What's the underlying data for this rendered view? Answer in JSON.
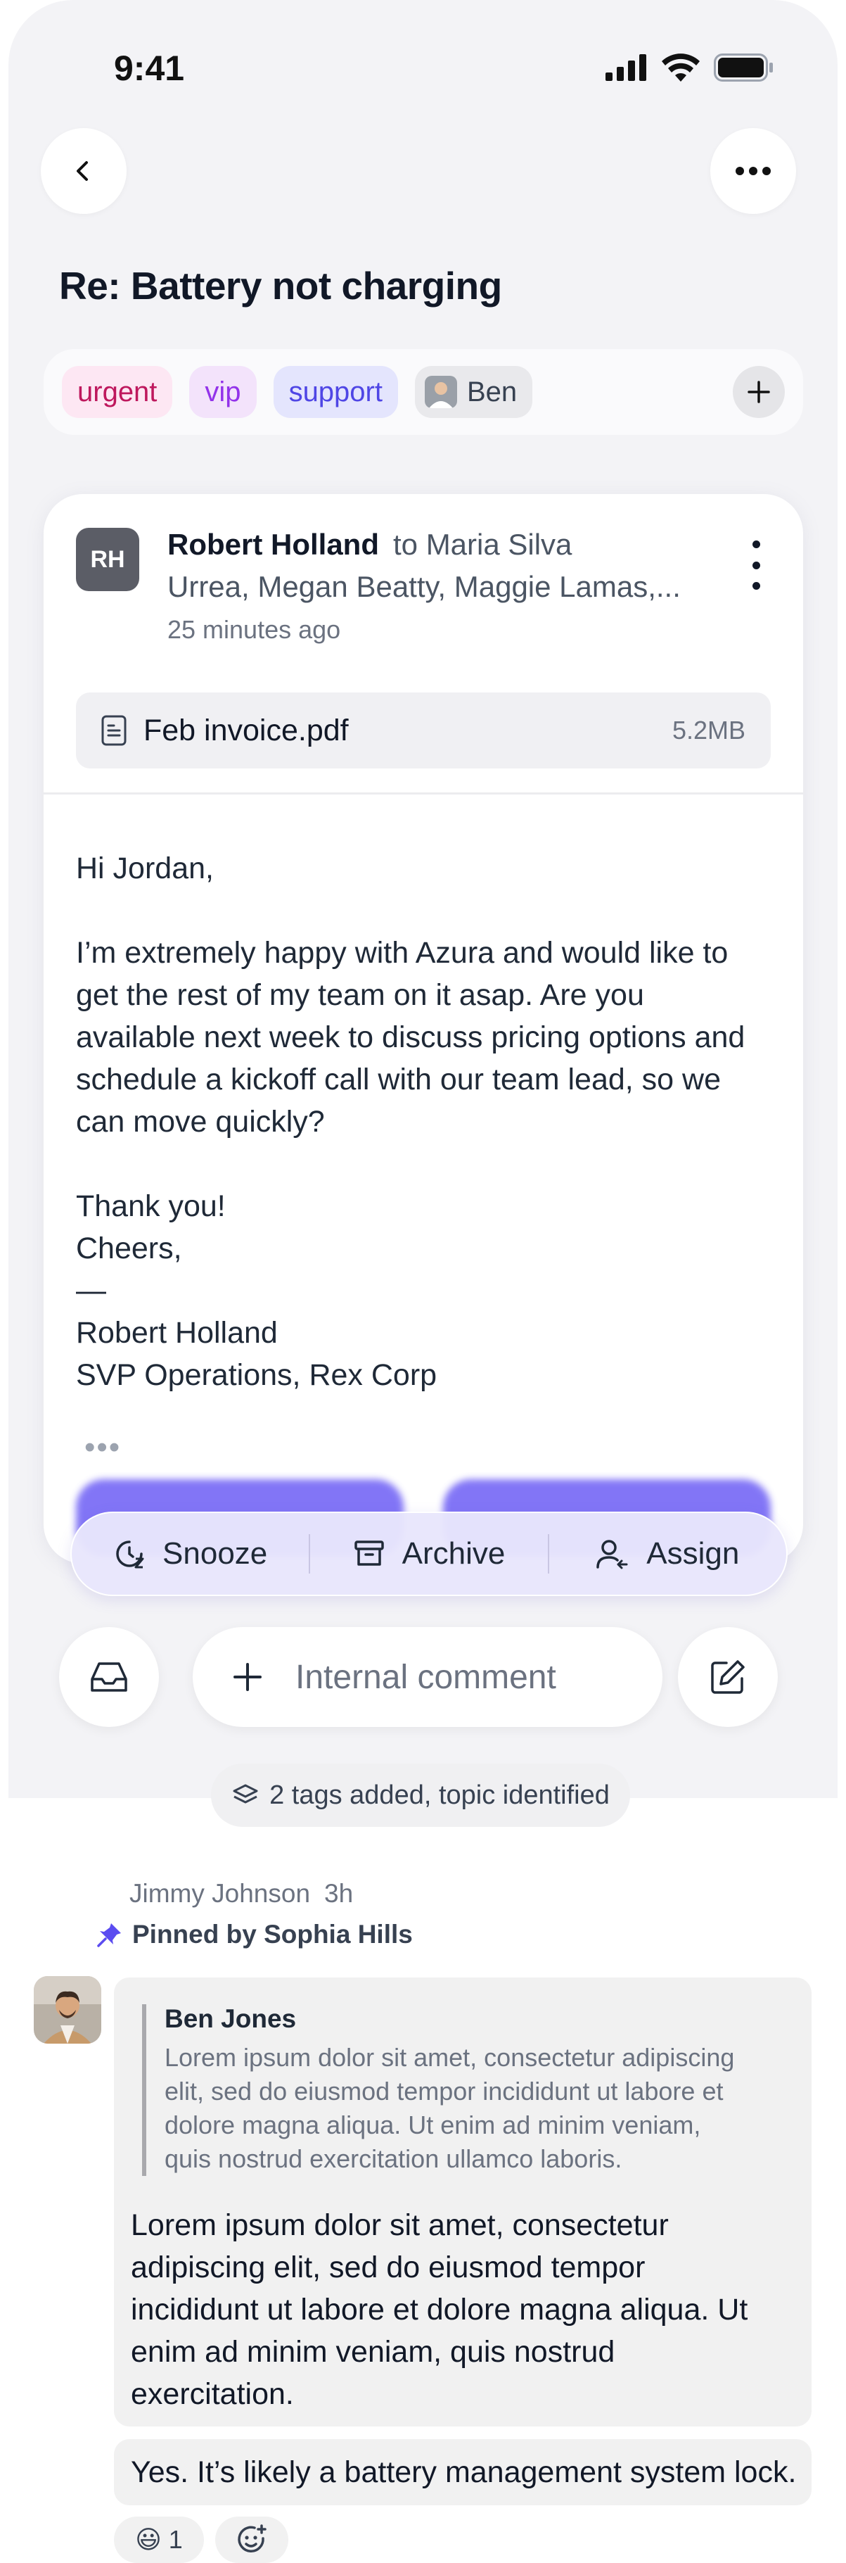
{
  "status_bar": {
    "time": "9:41"
  },
  "header": {
    "title": "Re: Battery not charging"
  },
  "tags": {
    "items": [
      "urgent",
      "vip",
      "support"
    ],
    "assignee": "Ben"
  },
  "email": {
    "avatar_initials": "RH",
    "sender": "Robert Holland",
    "to": "to Maria Silva",
    "cc": "Urrea, Megan Beatty, Maggie Lamas,...",
    "time": "25 minutes ago",
    "attachment": {
      "name": "Feb invoice.pdf",
      "size": "5.2MB"
    },
    "body": {
      "greeting": "Hi Jordan,",
      "lines": [
        "I’m extremely happy with Azura and would like to",
        "get the rest of my team on it asap. Are you",
        "available next week to discuss pricing options and",
        "schedule a kickoff call with our team lead, so we",
        "can move quickly?"
      ],
      "thanks": "Thank you!",
      "closing": "Cheers,",
      "dash": "—",
      "signature_name": "Robert Holland",
      "signature_title": "SVP Operations, Rex Corp"
    }
  },
  "actions": {
    "snooze": "Snooze",
    "archive": "Archive",
    "assign": "Assign"
  },
  "composer": {
    "placeholder": "Internal comment"
  },
  "event": {
    "text": "2 tags added, topic identified"
  },
  "thread": {
    "author": "Jimmy Johnson",
    "time": "3h",
    "pinned": "Pinned by Sophia Hills",
    "quote_author": "Ben Jones",
    "quote_lines": [
      "Lorem ipsum dolor sit amet, consectetur adipiscing",
      "elit, sed do eiusmod tempor incididunt ut labore et",
      "dolore magna aliqua. Ut enim ad minim veniam,",
      "quis nostrud exercitation ullamco laboris."
    ],
    "message_lines": [
      "Lorem ipsum dolor sit amet, consectetur",
      "adipiscing elit, sed do eiusmod tempor",
      "incididunt ut labore et dolore magna aliqua. Ut",
      "enim ad minim veniam, quis nostrud",
      "exercitation."
    ],
    "reply": "Yes. It’s likely a battery management system lock.",
    "reaction_emoji": "😃",
    "reaction_count": "1"
  },
  "colors": {
    "accent": "#6d5ef5",
    "urgent": "#be185d",
    "vip": "#9333ea",
    "support": "#4f46e5"
  }
}
